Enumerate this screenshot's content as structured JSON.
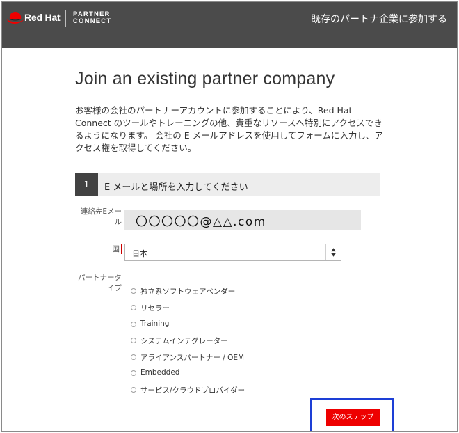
{
  "header": {
    "brand": "Red Hat",
    "product_line1": "PARTNER",
    "product_line2": "CONNECT",
    "right_text": "既存のパートナ企業に参加する"
  },
  "page": {
    "title": "Join an existing partner company",
    "intro": "お客様の会社のパートナーアカウントに参加することにより、Red Hat Connect のツールやトレーニングの他、貴重なリソースへ特別にアクセスできるようになります。 会社の E メールアドレスを使用してフォームに入力し、アクセス権を取得してください。"
  },
  "step": {
    "number": "1",
    "label": "E メールと場所を入力してください"
  },
  "form": {
    "email_label_line1": "連絡先Eメー",
    "email_label_line2": "ル",
    "email_value": "〇〇〇〇〇@△△.com",
    "country_label": "国",
    "country_value": "日本",
    "partner_type_label_line1": "パートナータ",
    "partner_type_label_line2": "イプ",
    "partner_types": [
      "独立系ソフトウェアベンダー",
      "リセラー",
      "Training",
      "システムインテグレーター",
      "アライアンスパートナー / OEM",
      "Embedded",
      "サービス/クラウドプロバイダー"
    ]
  },
  "next_button_label": "次のステップ",
  "colors": {
    "header_bg": "#4b4b4b",
    "brand_red": "#ee0000",
    "highlight_outline": "#1d3fd6",
    "step_number_bg": "#424242"
  },
  "icons": {
    "logo": "redhat-fedora-logo",
    "select": "up-down-arrows-icon",
    "radio": "radio-circle"
  }
}
